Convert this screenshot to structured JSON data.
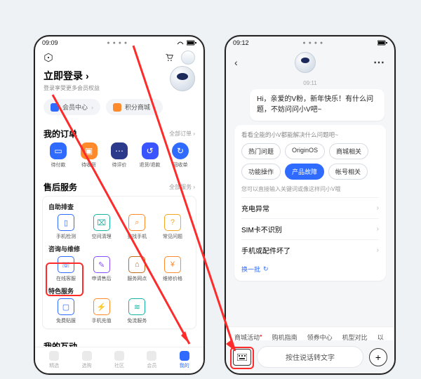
{
  "left": {
    "status_time": "09:09",
    "login_title": "立即登录",
    "login_sub": "登录享受更多会员权益",
    "pills": {
      "member": "会员中心",
      "points": "积分商城"
    },
    "orders": {
      "title": "我的订单",
      "more": "全部订单",
      "items": [
        "待付款",
        "待收货",
        "待评价",
        "退货/退款",
        "回收单"
      ]
    },
    "service": {
      "title": "售后服务",
      "more": "全部服务",
      "group1_title": "自助排查",
      "group1": [
        "手机检测",
        "空间清理",
        "查找手机",
        "常见问题"
      ],
      "group2_title": "咨询与维修",
      "group2": [
        "在线客服",
        "申请售后",
        "服务网点",
        "维修价格"
      ],
      "group3_title": "特色服务",
      "group3": [
        "免费贴膜",
        "手机充值",
        "免流服务"
      ]
    },
    "interact_title": "我的互动",
    "tabs": [
      "精选",
      "选购",
      "社区",
      "会员",
      "我的"
    ]
  },
  "right": {
    "status_time": "09:12",
    "time_center": "09:11",
    "greeting": "Hi，亲爱的V粉，新年快乐！有什么问题，不妨问问小V吧~",
    "faq_header": "看看全能的小V都能解决什么问题吧~",
    "chips": [
      "热门问题",
      "OriginOS",
      "商城相关",
      "功能操作",
      "产品故障",
      "帐号相关"
    ],
    "hint": "您可以直接输入关键词或像这样问小V哦",
    "qa": [
      "充电异常",
      "SIM卡不识别",
      "手机或配件坏了"
    ],
    "refresh": "换一批",
    "tags": [
      "商城活动",
      "购机指南",
      "领券中心",
      "机型对比",
      "以"
    ],
    "speech_placeholder": "按住说话转文字"
  }
}
